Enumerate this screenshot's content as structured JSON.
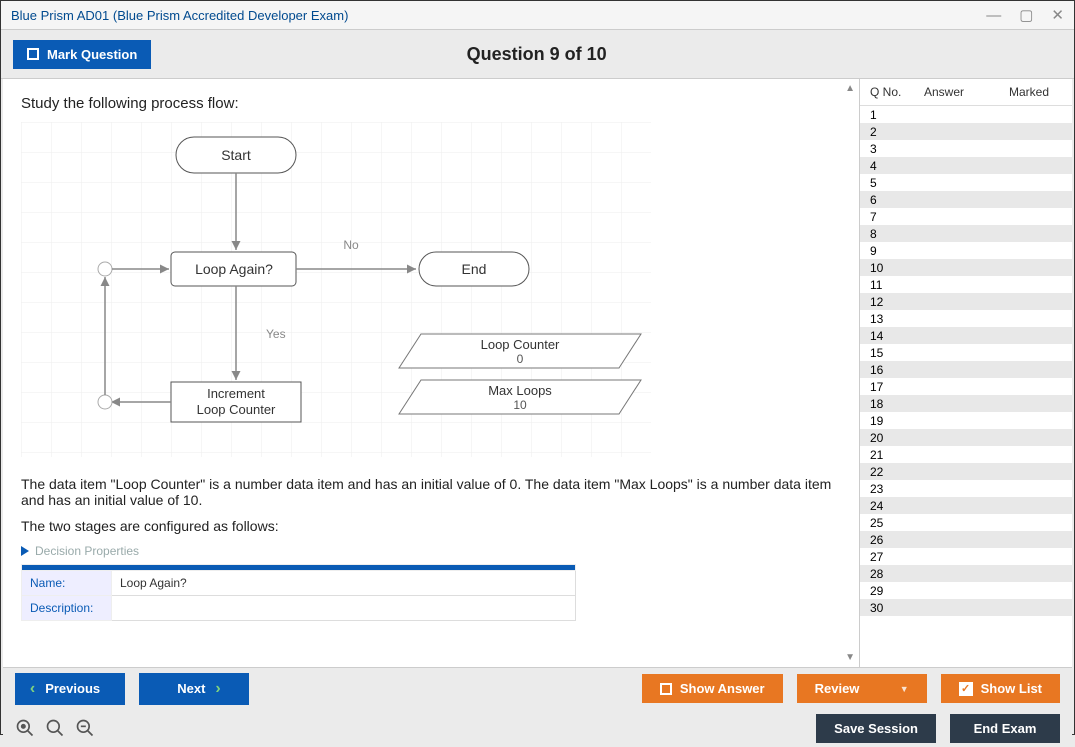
{
  "window": {
    "title": "Blue Prism AD01 (Blue Prism Accredited Developer Exam)"
  },
  "header": {
    "mark_label": "Mark Question",
    "question_title": "Question 9 of 10"
  },
  "question": {
    "prompt": "Study the following process flow:",
    "text1": "The data item \"Loop Counter\" is a number data item and has an initial value of 0. The data item \"Max Loops\" is a number data item and has an initial value of 10.",
    "text2": "The two stages are configured as follows:"
  },
  "diagram": {
    "start": "Start",
    "decision": "Loop Again?",
    "no_label": "No",
    "yes_label": "Yes",
    "end": "End",
    "action": "Increment\nLoop Counter",
    "data1_name": "Loop Counter",
    "data1_val": "0",
    "data2_name": "Max Loops",
    "data2_val": "10"
  },
  "props": {
    "header": "Decision Properties",
    "name_label": "Name:",
    "name_value": "Loop Again?",
    "desc_label": "Description:"
  },
  "sidebar": {
    "col_q": "Q No.",
    "col_a": "Answer",
    "col_m": "Marked",
    "rows": [
      "1",
      "2",
      "3",
      "4",
      "5",
      "6",
      "7",
      "8",
      "9",
      "10",
      "11",
      "12",
      "13",
      "14",
      "15",
      "16",
      "17",
      "18",
      "19",
      "20",
      "21",
      "22",
      "23",
      "24",
      "25",
      "26",
      "27",
      "28",
      "29",
      "30"
    ]
  },
  "footer": {
    "previous": "Previous",
    "next": "Next",
    "show_answer": "Show Answer",
    "review": "Review",
    "show_list": "Show List",
    "save_session": "Save Session",
    "end_exam": "End Exam"
  }
}
